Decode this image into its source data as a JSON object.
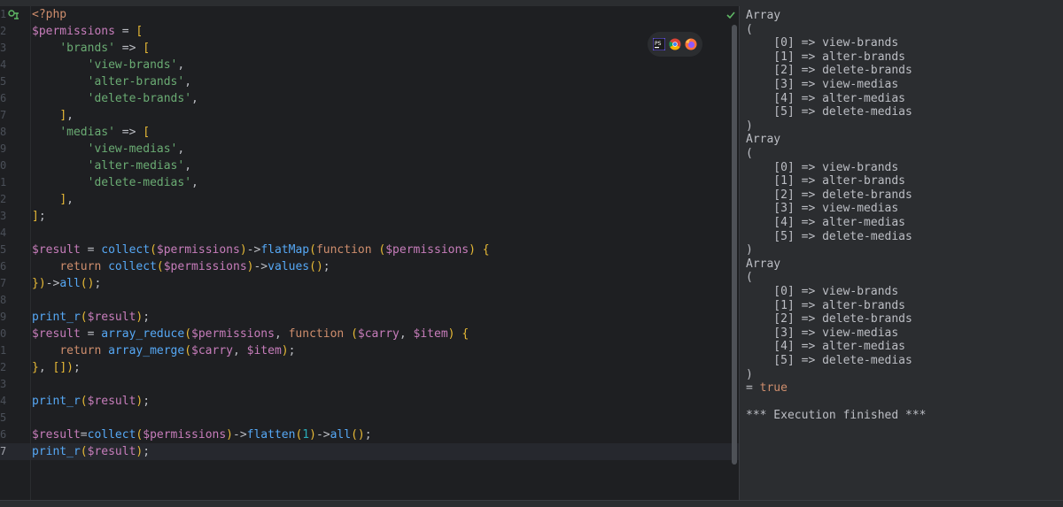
{
  "editor": {
    "line_numbers": [
      "1",
      "2",
      "3",
      "4",
      "5",
      "6",
      "7",
      "8",
      "9",
      "0",
      "1",
      "2",
      "3",
      "4",
      "5",
      "6",
      "7",
      "8",
      "9",
      "0",
      "1",
      "2",
      "3",
      "4",
      "5",
      "6",
      "7"
    ],
    "code_lines": [
      "<?php",
      "$permissions = [",
      "    'brands' => [",
      "        'view-brands',",
      "        'alter-brands',",
      "        'delete-brands',",
      "    ],",
      "    'medias' => [",
      "        'view-medias',",
      "        'alter-medias',",
      "        'delete-medias',",
      "    ],",
      "];",
      "",
      "$result = collect($permissions)->flatMap(function ($permissions) {",
      "    return collect($permissions)->values();",
      "})->all();",
      "",
      "print_r($result);",
      "$result = array_reduce($permissions, function ($carry, $item) {",
      "    return array_merge($carry, $item);",
      "}, []);",
      "",
      "print_r($result);",
      "",
      "$result=collect($permissions)->flatten(1)->all();",
      "print_r($result);"
    ],
    "current_line_index": 26,
    "browser_icons": [
      "phpstorm-icon",
      "chrome-icon",
      "firefox-icon"
    ],
    "colors": {
      "keyword": "#cf8e6d",
      "variable": "#c77dbb",
      "string": "#6aab73",
      "function": "#56a8f5",
      "number": "#2aacb8"
    }
  },
  "output": {
    "lines": [
      "Array",
      "(",
      "    [0] => view-brands",
      "    [1] => alter-brands",
      "    [2] => delete-brands",
      "    [3] => view-medias",
      "    [4] => alter-medias",
      "    [5] => delete-medias",
      ")",
      "Array",
      "(",
      "    [0] => view-brands",
      "    [1] => alter-brands",
      "    [2] => delete-brands",
      "    [3] => view-medias",
      "    [4] => alter-medias",
      "    [5] => delete-medias",
      ")",
      "Array",
      "(",
      "    [0] => view-brands",
      "    [1] => alter-brands",
      "    [2] => delete-brands",
      "    [3] => view-medias",
      "    [4] => alter-medias",
      "    [5] => delete-medias",
      ")",
      "= true",
      "",
      "*** Execution finished ***"
    ]
  }
}
